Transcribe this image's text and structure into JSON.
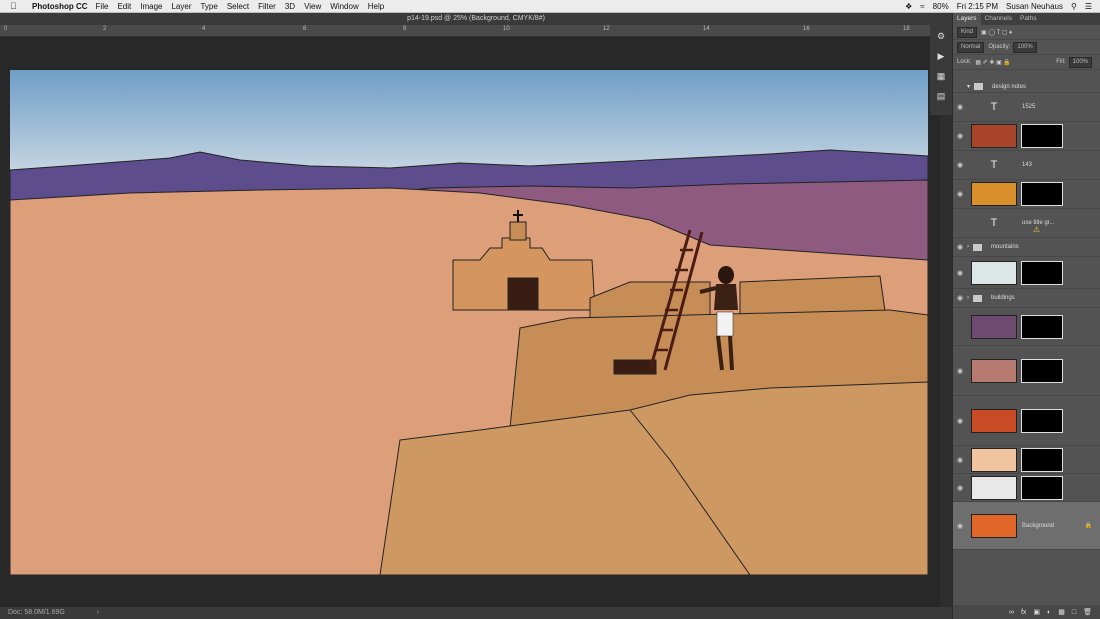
{
  "menubar": {
    "app_name": "Photoshop CC",
    "items": [
      "File",
      "Edit",
      "Image",
      "Layer",
      "Type",
      "Select",
      "Filter",
      "3D",
      "View",
      "Window",
      "Help"
    ],
    "battery": "80%",
    "clock": "Fri 2:15 PM",
    "user": "Susan Neuhaus"
  },
  "document": {
    "title": "p14-19.psd @ 25% (Background, CMYK/8#)",
    "status": "Doc: 58.0M/1.69G"
  },
  "ruler": [
    "0",
    "2",
    "4",
    "6",
    "8",
    "10",
    "12",
    "14",
    "16",
    "18"
  ],
  "panel": {
    "tabs": [
      "Layers",
      "Channels",
      "Paths"
    ],
    "kind_label": "Kind",
    "blend_mode": "Normal",
    "opacity_label": "Opacity:",
    "opacity_value": "100%",
    "lock_label": "Lock:",
    "fill_label": "Fill:",
    "fill_value": "100%"
  },
  "layers": [
    {
      "type": "group",
      "name": "design notes",
      "expanded": true
    },
    {
      "type": "text",
      "name": "1525"
    },
    {
      "type": "fill",
      "thumb_color": "#a8442a",
      "has_mask": true
    },
    {
      "type": "text",
      "name": "143"
    },
    {
      "type": "fill",
      "thumb_color": "#d9902a",
      "has_mask": true
    },
    {
      "type": "text",
      "name": "use title gr...",
      "warning": true
    },
    {
      "type": "group",
      "name": "mountains"
    },
    {
      "type": "image",
      "thumb_color": "#dde6e6",
      "has_mask": true
    },
    {
      "type": "group",
      "name": "buildings"
    },
    {
      "type": "image",
      "thumb_color": "#6f4a70",
      "has_mask": true
    },
    {
      "type": "image",
      "thumb_color": "#b67a70",
      "has_mask": true
    },
    {
      "type": "image",
      "thumb_color": "#c84b25",
      "has_mask": true
    },
    {
      "type": "image",
      "thumb_color": "#f0c49e",
      "has_mask": true
    },
    {
      "type": "image",
      "thumb_color": "#e8e8e8",
      "has_mask": true
    },
    {
      "type": "image",
      "name": "Background",
      "thumb_color": "#e0662a",
      "selected": true
    }
  ],
  "colors": {
    "sky_top": "#6f9ec7",
    "sky_bottom": "#e6eaec",
    "mountain_far": "#5e4d8d",
    "mountain_near": "#8e5a7f",
    "desert": "#dd9f79",
    "adobe": "#c68d57",
    "adobe_shadow": "#b07844"
  }
}
